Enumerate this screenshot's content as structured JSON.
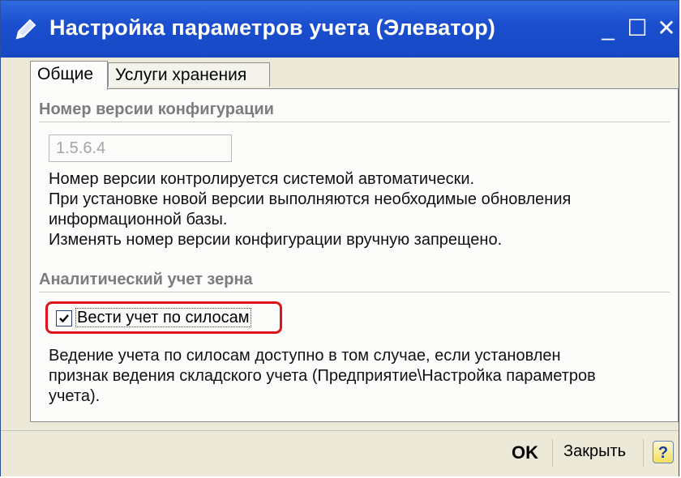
{
  "window": {
    "title": "Настройка параметров учета (Элеватор)",
    "minimize_label": "_",
    "maximize_label": "☐",
    "close_label": "✕"
  },
  "tabs": [
    {
      "label": "Общие",
      "active": true
    },
    {
      "label": "Услуги хранения",
      "active": false
    }
  ],
  "version_section": {
    "title": "Номер версии конфигурации",
    "value": "1.5.6.4",
    "lines": [
      "Номер версии контролируется системой автоматически.",
      "При установке новой версии выполняются необходимые обновления",
      "информационной базы.",
      "Изменять номер версии конфигурации вручную запрещено."
    ]
  },
  "grain_section": {
    "title": "Аналитический учет зерна",
    "checkbox_label": "Вести учет по силосам",
    "checked": true,
    "lines": [
      "Ведение учета по силосам доступно в том случае, если установлен",
      "признак ведения складского учета (Предприятие\\Настройка параметров",
      "учета)."
    ]
  },
  "footer": {
    "ok_label": "OK",
    "close_label": "Закрыть",
    "help_label": "?"
  }
}
